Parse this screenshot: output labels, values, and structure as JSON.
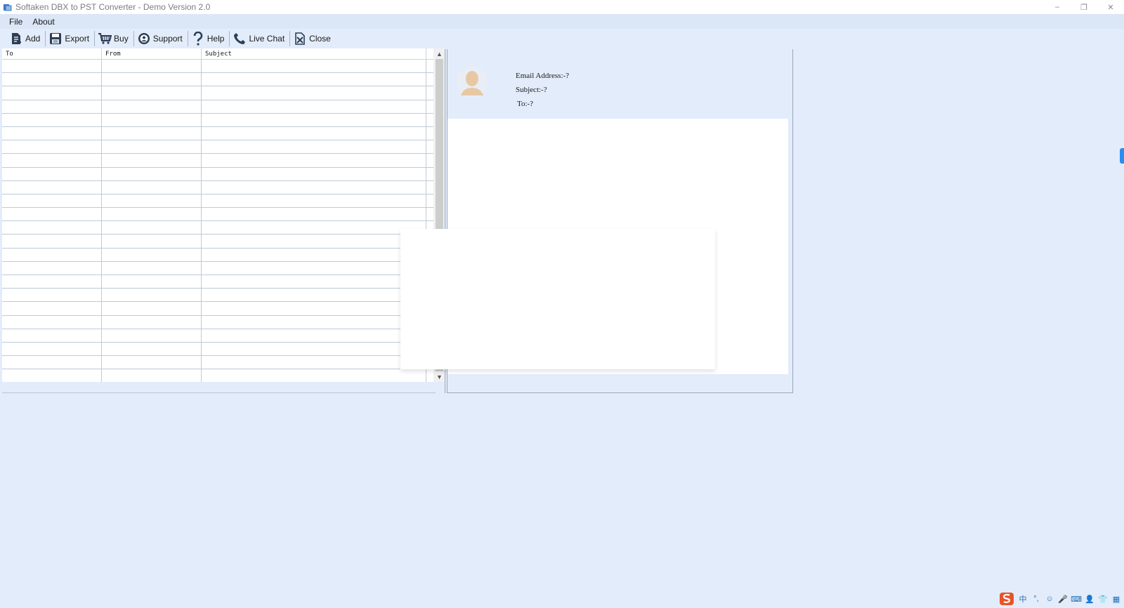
{
  "window": {
    "title": "Softaken DBX to PST Converter - Demo Version 2.0",
    "controls": {
      "minimize": "–",
      "restore": "❐",
      "close": "✕"
    }
  },
  "menu": {
    "items": [
      {
        "label": "File"
      },
      {
        "label": "About"
      }
    ]
  },
  "toolbar": {
    "buttons": [
      {
        "label": "Add",
        "icon": "add-file-icon"
      },
      {
        "label": "Export",
        "icon": "save-icon"
      },
      {
        "label": "Buy",
        "icon": "cart-icon"
      },
      {
        "label": "Support",
        "icon": "support-icon"
      },
      {
        "label": "Help",
        "icon": "help-icon"
      },
      {
        "label": "Live Chat",
        "icon": "phone-icon"
      },
      {
        "label": "Close",
        "icon": "close-file-icon"
      }
    ]
  },
  "message_list": {
    "columns": [
      "To",
      "From",
      "Subject"
    ],
    "rows": []
  },
  "preview": {
    "email_address_label": "Email Address:-?",
    "subject_label": "Subject:-?",
    "to_label": "To:-?",
    "body": ""
  },
  "colors": {
    "background": "#e3ecfa",
    "menubar": "#dbe6f6",
    "accent": "#2d8cf0"
  },
  "tray": {
    "items": [
      {
        "icon": "sogou-ime-icon"
      },
      {
        "label": "中",
        "icon": "ime-chinese-icon"
      },
      {
        "label": "°,",
        "icon": "punctuation-icon"
      },
      {
        "label": "☺",
        "icon": "emoji-icon"
      },
      {
        "label": "🎤",
        "icon": "microphone-icon"
      },
      {
        "label": "⌨",
        "icon": "keyboard-icon"
      },
      {
        "label": "👤",
        "icon": "user-icon"
      },
      {
        "label": "👕",
        "icon": "skin-icon"
      },
      {
        "label": "▦",
        "icon": "grid-menu-icon"
      }
    ]
  }
}
